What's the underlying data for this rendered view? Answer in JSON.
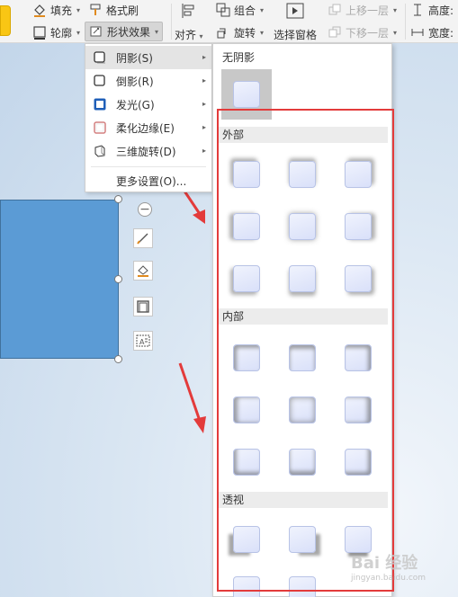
{
  "ribbon": {
    "fill_label": "填充",
    "format_painter_label": "格式刷",
    "outline_label": "轮廓",
    "shape_effects_label": "形状效果",
    "align_label": "对齐",
    "group_label": "组合",
    "rotate_label": "旋转",
    "selection_pane_label": "选择窗格",
    "bring_forward_label": "上移一层",
    "send_backward_label": "下移一层",
    "height_label": "高度:",
    "width_label": "宽度:"
  },
  "effects_menu": {
    "items": [
      {
        "label": "阴影(S)",
        "has_submenu": true
      },
      {
        "label": "倒影(R)",
        "has_submenu": true
      },
      {
        "label": "发光(G)",
        "has_submenu": true
      },
      {
        "label": "柔化边缘(E)",
        "has_submenu": true
      },
      {
        "label": "三维旋转(D)",
        "has_submenu": true
      }
    ],
    "more_settings_label": "更多设置(O)..."
  },
  "shadow_gallery": {
    "no_shadow_label": "无阴影",
    "sections": [
      {
        "title": "外部"
      },
      {
        "title": "内部"
      },
      {
        "title": "透视"
      }
    ]
  },
  "watermark": {
    "text": "Bai 经验",
    "sub": "jingyan.baidu.com"
  },
  "colors": {
    "shape_fill": "#5b9bd5",
    "highlight_box": "#e33b3b",
    "arrow": "#e33b3b",
    "brand_yellow": "#f9c614"
  }
}
